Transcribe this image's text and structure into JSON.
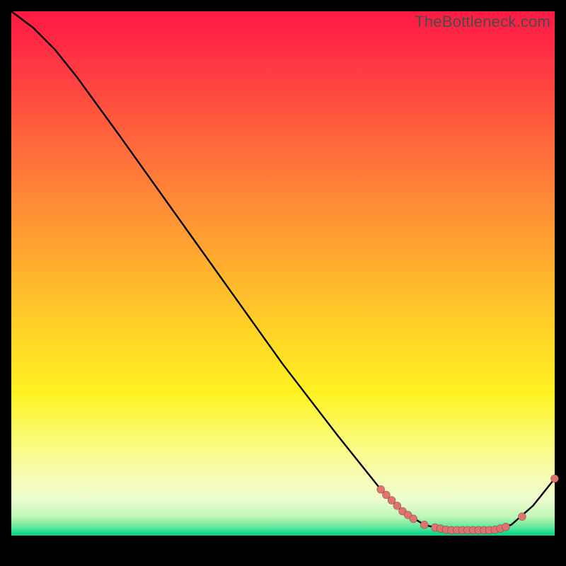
{
  "watermark": "TheBottleneck.com",
  "chart_data": {
    "type": "line",
    "title": "",
    "xlabel": "",
    "ylabel": "",
    "xlim": [
      0,
      100
    ],
    "ylim": [
      0,
      100
    ],
    "curve": [
      {
        "x": 0,
        "y": 100
      },
      {
        "x": 4,
        "y": 97
      },
      {
        "x": 8,
        "y": 93
      },
      {
        "x": 12,
        "y": 88
      },
      {
        "x": 20,
        "y": 77
      },
      {
        "x": 30,
        "y": 63
      },
      {
        "x": 40,
        "y": 49
      },
      {
        "x": 50,
        "y": 35
      },
      {
        "x": 60,
        "y": 22
      },
      {
        "x": 68,
        "y": 12
      },
      {
        "x": 72,
        "y": 8
      },
      {
        "x": 76,
        "y": 5.5
      },
      {
        "x": 80,
        "y": 4.5
      },
      {
        "x": 84,
        "y": 4.5
      },
      {
        "x": 88,
        "y": 4.5
      },
      {
        "x": 92,
        "y": 5.5
      },
      {
        "x": 96,
        "y": 9
      },
      {
        "x": 100,
        "y": 14
      }
    ],
    "points": [
      {
        "x": 68,
        "y": 12
      },
      {
        "x": 69,
        "y": 11
      },
      {
        "x": 70,
        "y": 10
      },
      {
        "x": 71,
        "y": 9
      },
      {
        "x": 72,
        "y": 8
      },
      {
        "x": 73,
        "y": 7.3
      },
      {
        "x": 74,
        "y": 6.6
      },
      {
        "x": 76,
        "y": 5.5
      },
      {
        "x": 78,
        "y": 5.0
      },
      {
        "x": 79,
        "y": 4.8
      },
      {
        "x": 80,
        "y": 4.6
      },
      {
        "x": 81,
        "y": 4.5
      },
      {
        "x": 82,
        "y": 4.5
      },
      {
        "x": 83,
        "y": 4.5
      },
      {
        "x": 84,
        "y": 4.5
      },
      {
        "x": 85,
        "y": 4.5
      },
      {
        "x": 86,
        "y": 4.5
      },
      {
        "x": 87,
        "y": 4.5
      },
      {
        "x": 88,
        "y": 4.5
      },
      {
        "x": 89,
        "y": 4.6
      },
      {
        "x": 90,
        "y": 4.8
      },
      {
        "x": 91,
        "y": 5.1
      },
      {
        "x": 94,
        "y": 7.0
      },
      {
        "x": 100,
        "y": 14
      }
    ],
    "colors": {
      "line": "#000000",
      "points": "#e0736e",
      "gradient_top": "#ff1a44",
      "gradient_bottom_band": "#0bd18a",
      "background": "#000000"
    }
  }
}
